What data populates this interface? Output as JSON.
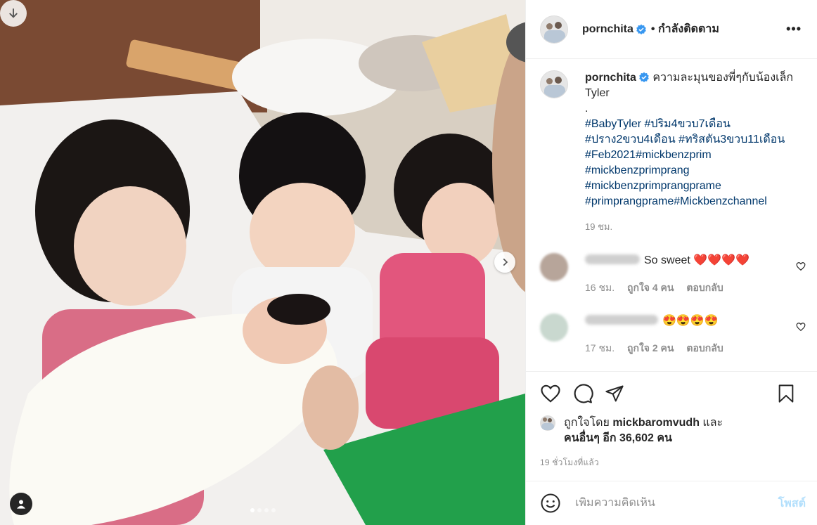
{
  "header": {
    "username": "pornchita",
    "follow_status": "• กำลังติดตาม",
    "more": "•••"
  },
  "caption": {
    "username": "pornchita",
    "text": "ความละมุนของพี่ๆกับน้องเล็ก Tyler",
    "dot": ".",
    "tags": [
      "#BabyTyler #ปริม4ขวบ7เดือน",
      "#ปราง2ขวบ4เดือน #ทริสตัน3ขวบ11เดือน",
      "#Feb2021#mickbenzprim",
      "#mickbenzprimprang",
      "#mickbenzprimprangprame",
      "#primprangprame#Mickbenzchannel"
    ],
    "time": "19 ชม."
  },
  "comments": [
    {
      "text": "So sweet ❤️❤️❤️❤️",
      "time": "16 ชม.",
      "likes": "ถูกใจ 4 คน",
      "reply": "ตอบกลับ",
      "avatar_color": "#b7a59a"
    },
    {
      "text": "😍😍😍😍",
      "time": "17 ชม.",
      "likes": "ถูกใจ 2 คน",
      "reply": "ตอบกลับ",
      "avatar_color": "#c9d8cf"
    }
  ],
  "likes": {
    "prefix": "ถูกใจโดย",
    "user": "mickbaromvudh",
    "and": "และ",
    "others": "คนอื่นๆ อีก 36,602 คน"
  },
  "posted_ago": "19 ชั่วโมงที่แล้ว",
  "add_comment": {
    "placeholder": "เพิ่มความคิดเห็น",
    "post_label": "โพสต์"
  },
  "carousel": {
    "current": 1,
    "total": 4
  },
  "icons": {
    "verified": "verified-badge-icon",
    "heart": "heart-icon",
    "comment": "comment-icon",
    "share": "share-icon",
    "save": "save-icon",
    "emoji": "emoji-icon"
  },
  "colors": {
    "link": "#00376b",
    "verified": "#3897f0",
    "muted": "#8e8e8e",
    "post_disabled": "#b2dffc"
  }
}
